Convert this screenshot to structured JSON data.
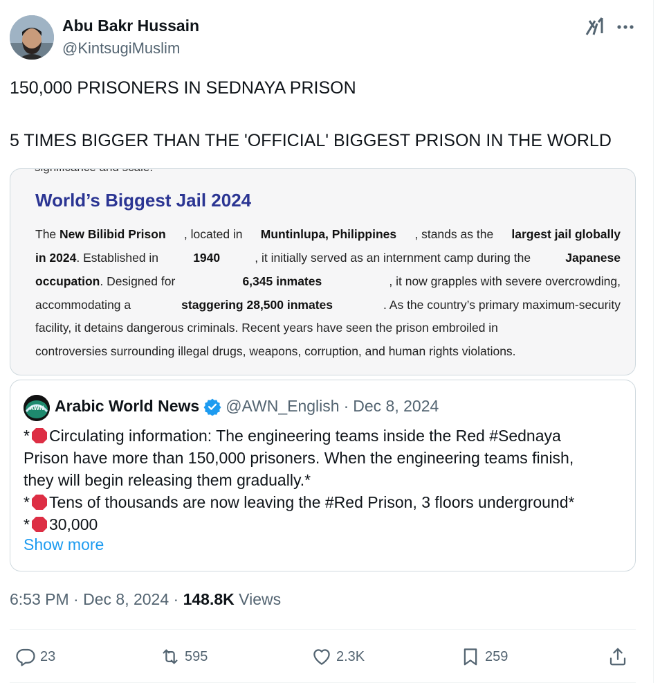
{
  "author": {
    "name": "Abu Bakr Hussain",
    "handle": "@KintsugiMuslim"
  },
  "tweet": {
    "line1": "150,000 PRISONERS IN SEDNAYA PRISON",
    "line2": "5 TIMES BIGGER THAN THE 'OFFICIAL' BIGGEST PRISON IN THE WORLD"
  },
  "image": {
    "top_crop": "significance and scale.",
    "heading": "World’s Biggest Jail 2024",
    "lines": [
      [
        "The",
        "New Bilibid Prison",
        ", located in",
        "Muntinlupa, Philippines",
        ", stands as the",
        "largest jail globally"
      ],
      [
        "in 2024",
        ". Established in",
        "1940",
        ", it initially served as an internment camp during the",
        "Japanese"
      ],
      [
        "occupation",
        ". Designed for",
        "6,345 inmates",
        ", it now grapples with severe overcrowding,"
      ],
      [
        "accommodating a",
        "staggering 28,500 inmates",
        ". As the country’s primary maximum-security"
      ],
      [
        "facility, it detains dangerous criminals. Recent years have seen the prison embroiled in"
      ],
      [
        "controversies surrounding illegal drugs, weapons, corruption, and human rights violations."
      ]
    ]
  },
  "quote": {
    "name": "Arabic World News",
    "handle": "@AWN_English",
    "separator": "·",
    "date": "Dec 8, 2024",
    "line1": "Circulating information: The engineering teams inside the Red #Sednaya",
    "line2": "Prison have more than 150,000 prisoners. When the engineering teams finish,",
    "line3": "they will begin releasing them gradually.*",
    "line4": "Tens of thousands are now leaving the #Red Prison, 3 floors underground*",
    "line5": "30,000",
    "asterisk": "*",
    "show_more": "Show more"
  },
  "meta": {
    "time": "6:53 PM",
    "sep": "·",
    "date": "Dec 8, 2024",
    "views_count": "148.8K",
    "views_label": "Views"
  },
  "actions": {
    "replies": "23",
    "reposts": "595",
    "likes": "2.3K",
    "bookmarks": "259"
  },
  "colors": {
    "accent": "#1d9bf0",
    "muted": "#536471",
    "heading_blue": "#2b3593",
    "stop_red": "#dd2e44"
  }
}
